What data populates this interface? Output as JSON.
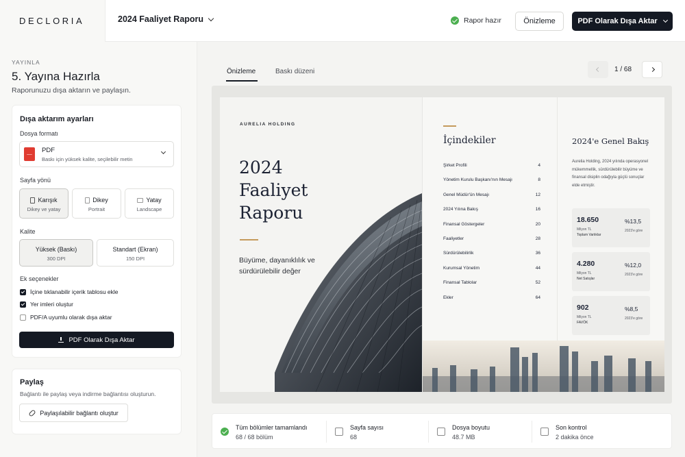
{
  "app": {
    "logo": "DECLORIA",
    "report_selector": "2024 Faaliyet Raporu",
    "status": "Rapor hazır",
    "preview_button": "Önizleme",
    "export_button": "PDF Olarak Dışa Aktar"
  },
  "sidebar": {
    "eyebrow": "YAYINLA",
    "title": "5. Yayına Hazırla",
    "subtitle": "Raporunuzu dışa aktarın ve paylaşın.",
    "export_settings": {
      "heading": "Dışa aktarım ayarları",
      "format_label": "Dosya formatı",
      "format": {
        "name": "PDF",
        "description": "Baskı için yüksek kalite, seçilebilir metin"
      },
      "orientation_label": "Sayfa yönü",
      "orientations": [
        {
          "title": "Karışık",
          "sub": "Dikey ve yatay",
          "active": true
        },
        {
          "title": "Dikey",
          "sub": "Portrait",
          "active": false
        },
        {
          "title": "Yatay",
          "sub": "Landscape",
          "active": false
        }
      ],
      "quality_label": "Kalite",
      "qualities": [
        {
          "title": "Yüksek (Baskı)",
          "sub": "300 DPI",
          "active": true
        },
        {
          "title": "Standart (Ekran)",
          "sub": "150 DPI",
          "active": false
        }
      ],
      "extras_label": "Ek seçenekler",
      "extras": [
        {
          "label": "İçine tıklanabilir içerik tablosu ekle",
          "checked": true
        },
        {
          "label": "Yer imleri oluştur",
          "checked": true
        },
        {
          "label": "PDF/A uyumlu olarak dışa aktar",
          "checked": false
        }
      ],
      "export_button": "PDF Olarak Dışa Aktar"
    },
    "share": {
      "heading": "Paylaş",
      "subtitle": "Bağlantı ile paylaş veya indirme bağlantısı oluşturun.",
      "button": "Paylaşılabilir bağlantı oluştur"
    }
  },
  "main": {
    "tabs": [
      {
        "label": "Önizleme",
        "active": true
      },
      {
        "label": "Baskı düzeni",
        "active": false
      }
    ],
    "pager": "1 / 68",
    "cover": {
      "brand": "AURELIA HOLDING",
      "title": "2024 Faaliyet Raporu",
      "subtitle": "Büyüme, dayanıklılık ve sürdürülebilir değer"
    },
    "toc": {
      "title": "İçindekiler",
      "items": [
        {
          "label": "Şirket Profili",
          "page": "4"
        },
        {
          "label": "Yönetim Kurulu Başkanı'nın Mesajı",
          "page": "8"
        },
        {
          "label": "Genel Müdür'ün Mesajı",
          "page": "12"
        },
        {
          "label": "2024 Yılına Bakış",
          "page": "16"
        },
        {
          "label": "Finansal Göstergeler",
          "page": "20"
        },
        {
          "label": "Faaliyetler",
          "page": "28"
        },
        {
          "label": "Sürdürülebilirlik",
          "page": "36"
        },
        {
          "label": "Kurumsal Yönetim",
          "page": "44"
        },
        {
          "label": "Finansal Tablolar",
          "page": "52"
        },
        {
          "label": "Ekler",
          "page": "64"
        }
      ]
    },
    "overview": {
      "title": "2024'e Genel Bakış",
      "text": "Aurelia Holding, 2024 yılında operasyonel mükemmellik, sürdürülebilir büyüme ve finansal disiplin odağıyla güçlü sonuçlar elde etmiştir.",
      "stats": [
        {
          "value": "18.650",
          "unit": "Milyon TL",
          "label": "Toplam Varlıklar",
          "pct": "%13,5",
          "compare": "2023'e göre"
        },
        {
          "value": "4.280",
          "unit": "Milyon TL",
          "label": "Net Satışlar",
          "pct": "%12,0",
          "compare": "2023'e göre"
        },
        {
          "value": "902",
          "unit": "Milyon TL",
          "label": "FAVÖK",
          "pct": "%8,5",
          "compare": "2023'e göre"
        }
      ]
    },
    "footer": [
      {
        "title": "Tüm bölümler tamamlandı",
        "value": "68 / 68 bölüm",
        "icon": "check-circle-icon"
      },
      {
        "title": "Sayfa sayısı",
        "value": "68",
        "icon": "pages-icon"
      },
      {
        "title": "Dosya boyutu",
        "value": "48.7 MB",
        "icon": "file-size-icon"
      },
      {
        "title": "Son kontrol",
        "value": "2 dakika önce",
        "icon": "last-check-icon"
      }
    ]
  }
}
